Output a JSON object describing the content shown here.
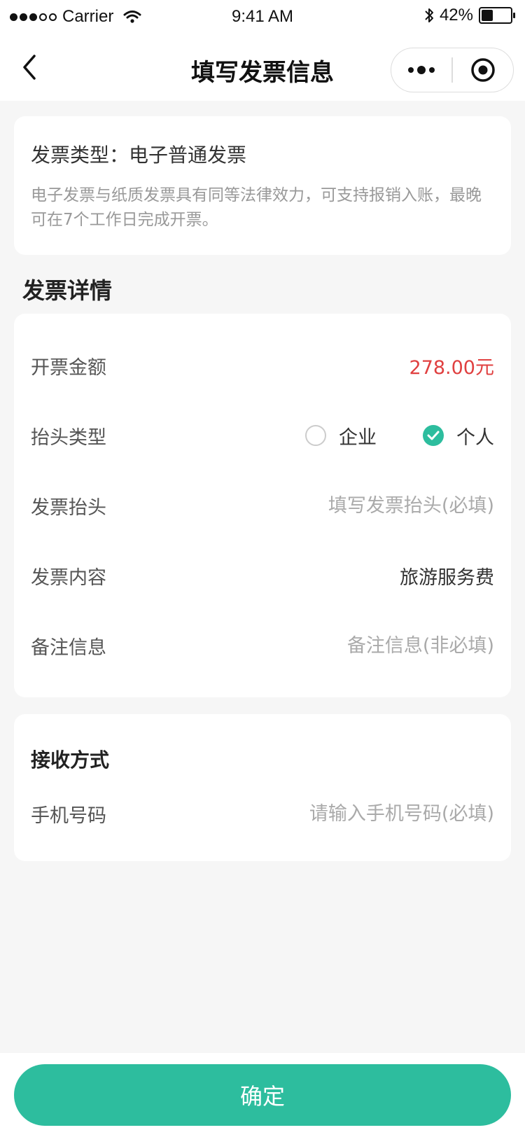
{
  "status_bar": {
    "carrier": "Carrier",
    "time": "9:41 AM",
    "battery": "42%",
    "battery_level": 0.42
  },
  "nav": {
    "title": "填写发票信息",
    "back_icon": "chevron-left-icon",
    "more_icon": "more-dots-icon",
    "close_icon": "target-circle-icon"
  },
  "invoice_type": {
    "title": "发票类型：电子普通发票",
    "description": "电子发票与纸质发票具有同等法律效力，可支持报销入账，最晚可在7个工作日完成开票。"
  },
  "details": {
    "section_title": "发票详情",
    "amount": {
      "label": "开票金额",
      "value": "278.00元"
    },
    "header_type": {
      "label": "抬头类型",
      "options": [
        {
          "label": "企业",
          "checked": false
        },
        {
          "label": "个人",
          "checked": true
        }
      ]
    },
    "header": {
      "label": "发票抬头",
      "placeholder": "填写发票抬头(必填)"
    },
    "content": {
      "label": "发票内容",
      "value": "旅游服务费"
    },
    "remark": {
      "label": "备注信息",
      "placeholder": "备注信息(非必填)"
    }
  },
  "receive": {
    "title": "接收方式",
    "phone": {
      "label": "手机号码",
      "placeholder": "请输入手机号码(必填)"
    }
  },
  "confirm_label": "确定",
  "colors": {
    "accent": "#2dbd9e",
    "price": "#e04040",
    "background": "#f6f6f6"
  }
}
